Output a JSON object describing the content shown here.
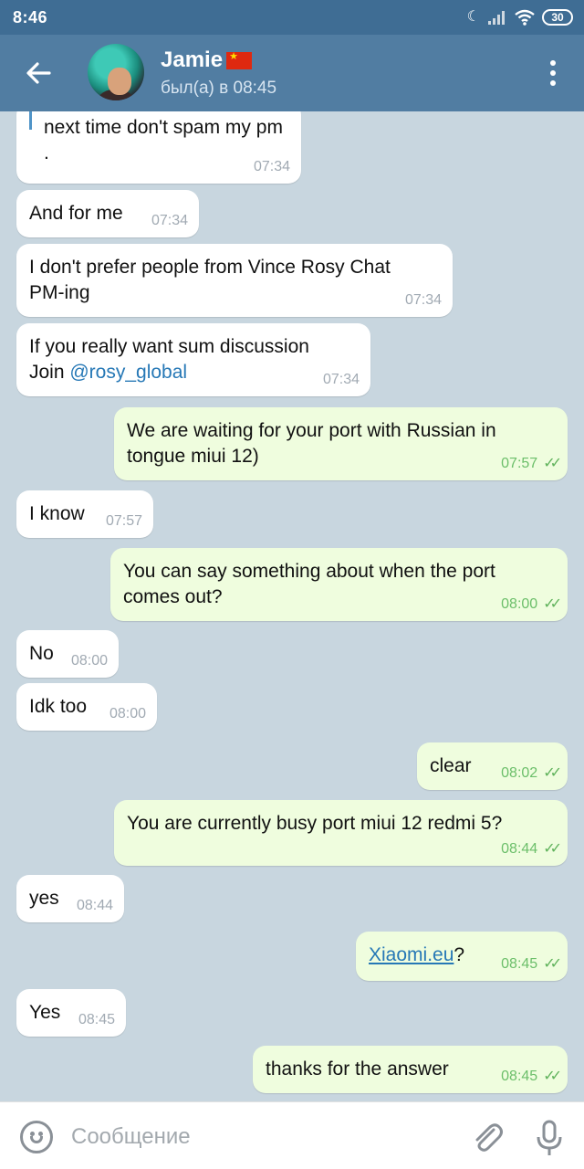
{
  "status_bar": {
    "time": "8:46",
    "battery": "30"
  },
  "header": {
    "name": "Jamie",
    "status": "был(а) в 08:45"
  },
  "messages": [
    {
      "dir": "in",
      "text": "next time don't spam my pm\n.",
      "time": "07:34"
    },
    {
      "dir": "in",
      "text": "And for me",
      "time": "07:34"
    },
    {
      "dir": "in",
      "text": "I don't prefer people from Vince Rosy Chat\nPM-ing",
      "time": "07:34"
    },
    {
      "dir": "in",
      "text_prefix": "If you really want sum discussion\nJoin ",
      "link": "@rosy_global",
      "time": "07:34"
    },
    {
      "dir": "out",
      "text": "We are waiting for your port with Russian in\ntongue miui 12)",
      "time": "07:57"
    },
    {
      "dir": "in",
      "text": "I know",
      "time": "07:57"
    },
    {
      "dir": "out",
      "text": "You can say something about when the port\ncomes out?",
      "time": "08:00"
    },
    {
      "dir": "in",
      "text": "No",
      "time": "08:00"
    },
    {
      "dir": "in",
      "text": "Idk too",
      "time": "08:00"
    },
    {
      "dir": "out",
      "text": "clear",
      "time": "08:02"
    },
    {
      "dir": "out",
      "text": "You are currently busy port miui 12 redmi 5?",
      "time": "08:44"
    },
    {
      "dir": "in",
      "text": "yes",
      "time": "08:44"
    },
    {
      "dir": "out",
      "link": "Xiaomi.eu",
      "text_suffix": "?",
      "time": "08:45"
    },
    {
      "dir": "in",
      "text": "Yes",
      "time": "08:45"
    },
    {
      "dir": "out",
      "text": "thanks for the answer",
      "time": "08:45"
    }
  ],
  "composer": {
    "placeholder": "Сообщение"
  },
  "icons": {
    "back": "arrow-left-icon",
    "menu": "more-vertical-icon",
    "emoji": "emoji-icon",
    "attach": "paperclip-icon",
    "mic": "microphone-icon",
    "read_receipt": "double-check-icon"
  },
  "colors": {
    "header": "#517da2",
    "status_bar": "#3f6d94",
    "outgoing_bubble": "#effdde",
    "incoming_bubble": "#ffffff",
    "chat_background": "#c8d6df",
    "link": "#2678b6",
    "read_ticks": "#5fb25b"
  }
}
